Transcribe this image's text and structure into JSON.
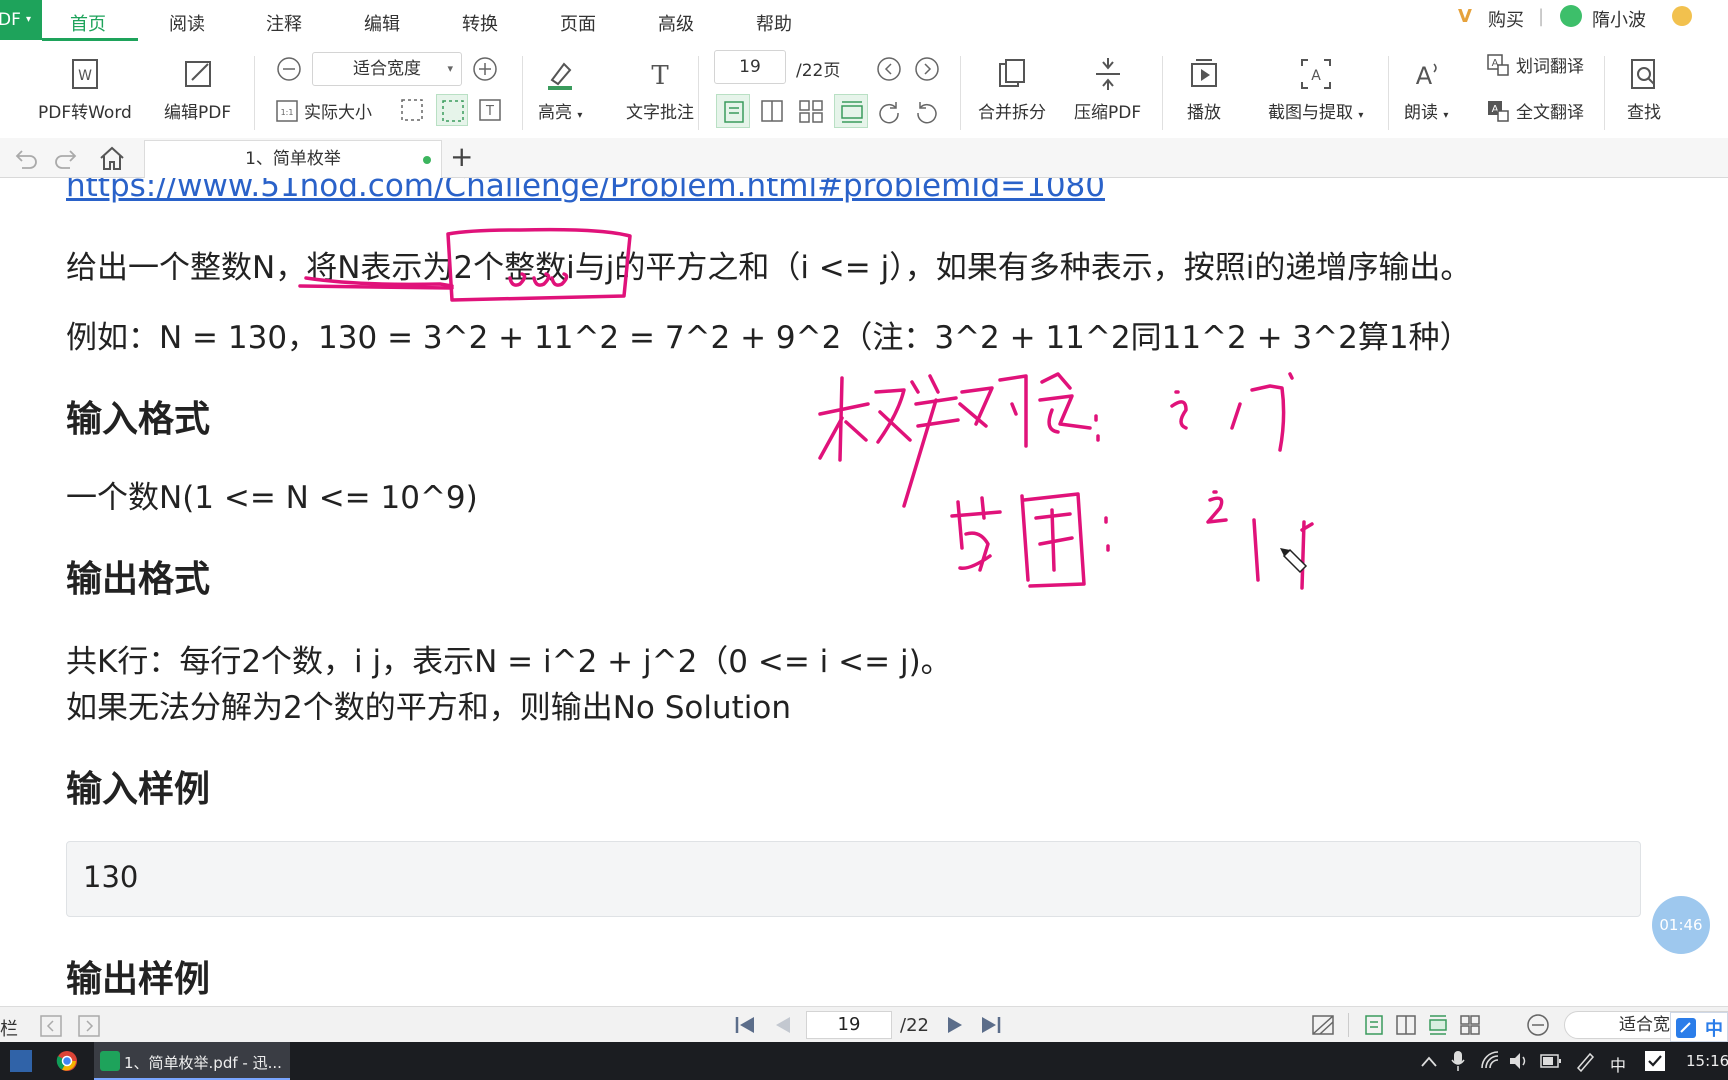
{
  "app": {
    "badge": "DF"
  },
  "menu": {
    "items": [
      "首页",
      "阅读",
      "注释",
      "编辑",
      "转换",
      "页面",
      "高级",
      "帮助"
    ],
    "buy_label": "购买",
    "user_name": "隋小波"
  },
  "toolbar": {
    "pdf_to_word": "PDF转Word",
    "edit_pdf": "编辑PDF",
    "fit_width": "适合宽度",
    "actual_size": "实际大小",
    "highlight": "高亮",
    "text_comment": "文字批注",
    "page_current": "19",
    "page_total": "/22页",
    "merge_split": "合并拆分",
    "compress_pdf": "压缩PDF",
    "play": "播放",
    "screenshot_extract": "截图与提取",
    "read_aloud": "朗读",
    "word_translate": "划词翻译",
    "full_translate": "全文翻译",
    "search": "查找"
  },
  "tabs": {
    "doc_tab": "1、简单枚举",
    "add": "+"
  },
  "document": {
    "link": "https://www.51nod.com/Challenge/Problem.html#problemId=1080",
    "desc": "给出一个整数N，将N表示为2个整数i与j的平方之和（i <= j），如果有多种表示，按照i的递增序输出。",
    "example": "例如：N = 130，130 = 3^2 + 11^2 = 7^2 + 9^2（注：3^2 + 11^2同11^2 + 3^2算1种）",
    "input_heading": "输入格式",
    "input_desc": "一个数N(1 <= N <= 10^9)",
    "output_heading": "输出格式",
    "output_desc_1": "共K行：每行2个数，i j，表示N = i^2 + j^2（0 <= i <= j)。",
    "output_desc_2": "如果无法分解为2个数的平方和，则输出No Solution",
    "sample_in_heading": "输入样例",
    "sample_in_value": "130",
    "sample_out_heading": "输出样例",
    "ink_color": "#e0127a"
  },
  "timer": "01:46",
  "statusbar": {
    "page_current": "19",
    "page_total": "/22",
    "zoom": "适合宽"
  },
  "taskbar": {
    "window_title": "1、简单枚举.pdf - 迅...",
    "ime": "中",
    "time": "15:16"
  }
}
